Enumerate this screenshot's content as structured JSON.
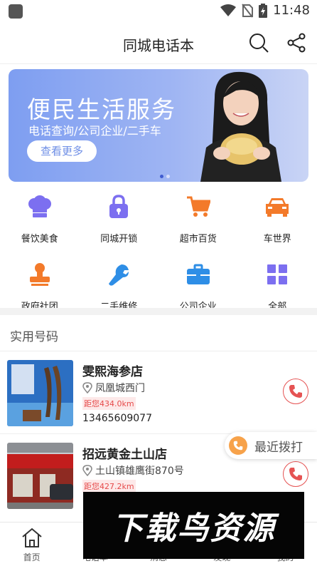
{
  "status_bar": {
    "time": "11:48"
  },
  "header": {
    "title": "同城电话本",
    "search_icon": "search-icon",
    "share_icon": "share-icon"
  },
  "banner": {
    "title": "便民生活服务",
    "subtitle": "电话查询/公司企业/二手车",
    "button_label": "查看更多",
    "page_count": 2,
    "active_page": 1
  },
  "categories": [
    {
      "label": "餐饮美食",
      "icon": "chef-hat-icon",
      "color": "#7c6ff0"
    },
    {
      "label": "同城开锁",
      "icon": "lock-icon",
      "color": "#7c6ff0"
    },
    {
      "label": "超市百货",
      "icon": "cart-icon",
      "color": "#f37a2a"
    },
    {
      "label": "车世界",
      "icon": "car-icon",
      "color": "#f37a2a"
    },
    {
      "label": "政府社团",
      "icon": "stamp-icon",
      "color": "#f37a2a"
    },
    {
      "label": "二手维修",
      "icon": "wrench-icon",
      "color": "#2e8ee6"
    },
    {
      "label": "公司企业",
      "icon": "briefcase-icon",
      "color": "#2e8ee6"
    },
    {
      "label": "全部",
      "icon": "grid-icon",
      "color": "#7c6ff0"
    }
  ],
  "section_title": "实用号码",
  "listings": [
    {
      "name": "雯熙海参店",
      "address": "凤凰城西门",
      "distance": "距您434.0km",
      "phone": "13465609077"
    },
    {
      "name": "招远黄金土山店",
      "address": "土山镇雄鹰街870号",
      "distance": "距您427.2km",
      "phone": ""
    }
  ],
  "recent_dial": {
    "label": "最近拨打"
  },
  "tabs": [
    {
      "label": "首页",
      "icon": "home-icon"
    },
    {
      "label": "电话本",
      "icon": "phonebook-icon"
    },
    {
      "label": "消息",
      "icon": "message-icon"
    },
    {
      "label": "发现",
      "icon": "discover-icon"
    },
    {
      "label": "我的",
      "icon": "profile-icon"
    }
  ],
  "watermark": {
    "text": "下载鸟资源"
  },
  "colors": {
    "accent_purple": "#7c6ff0",
    "accent_orange": "#f37a2a",
    "accent_blue": "#2e8ee6",
    "call_red": "#e55353",
    "distance_red": "#e64a4a"
  }
}
